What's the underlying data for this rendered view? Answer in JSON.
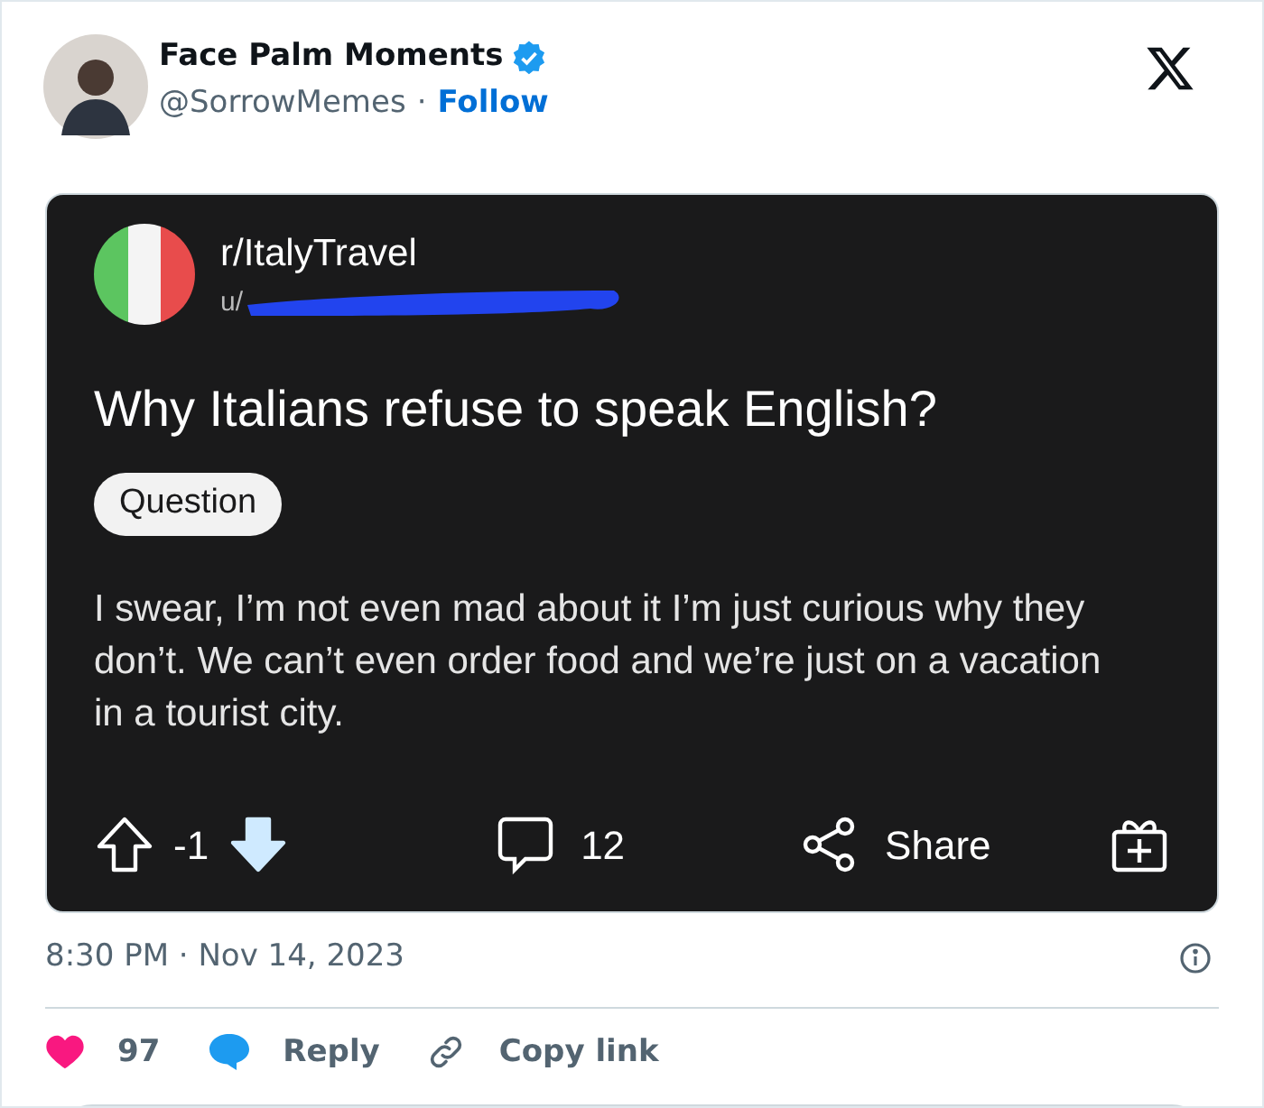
{
  "author": {
    "name": "Face Palm Moments",
    "verified": true,
    "handle": "@SorrowMemes",
    "separator": "·",
    "follow": "Follow"
  },
  "post": {
    "community": "r/ItalyTravel",
    "user": "u/",
    "user_redacted": true,
    "title": "Why Italians refuse to speak English?",
    "flair": "Question",
    "body": "I swear, I’m not even mad about it I’m just curious why they don’t. We can’t even order food and we’re just on a vacation in a tourist city.",
    "score": "-1",
    "upvoted": false,
    "downvoted": true,
    "comments": "12",
    "share": "Share"
  },
  "timestamp": "8:30 PM · Nov 14, 2023",
  "actions": [
    {
      "kind": "like",
      "label": "97"
    },
    {
      "kind": "reply",
      "label": "Reply"
    },
    {
      "kind": "copy",
      "label": "Copy link"
    }
  ]
}
